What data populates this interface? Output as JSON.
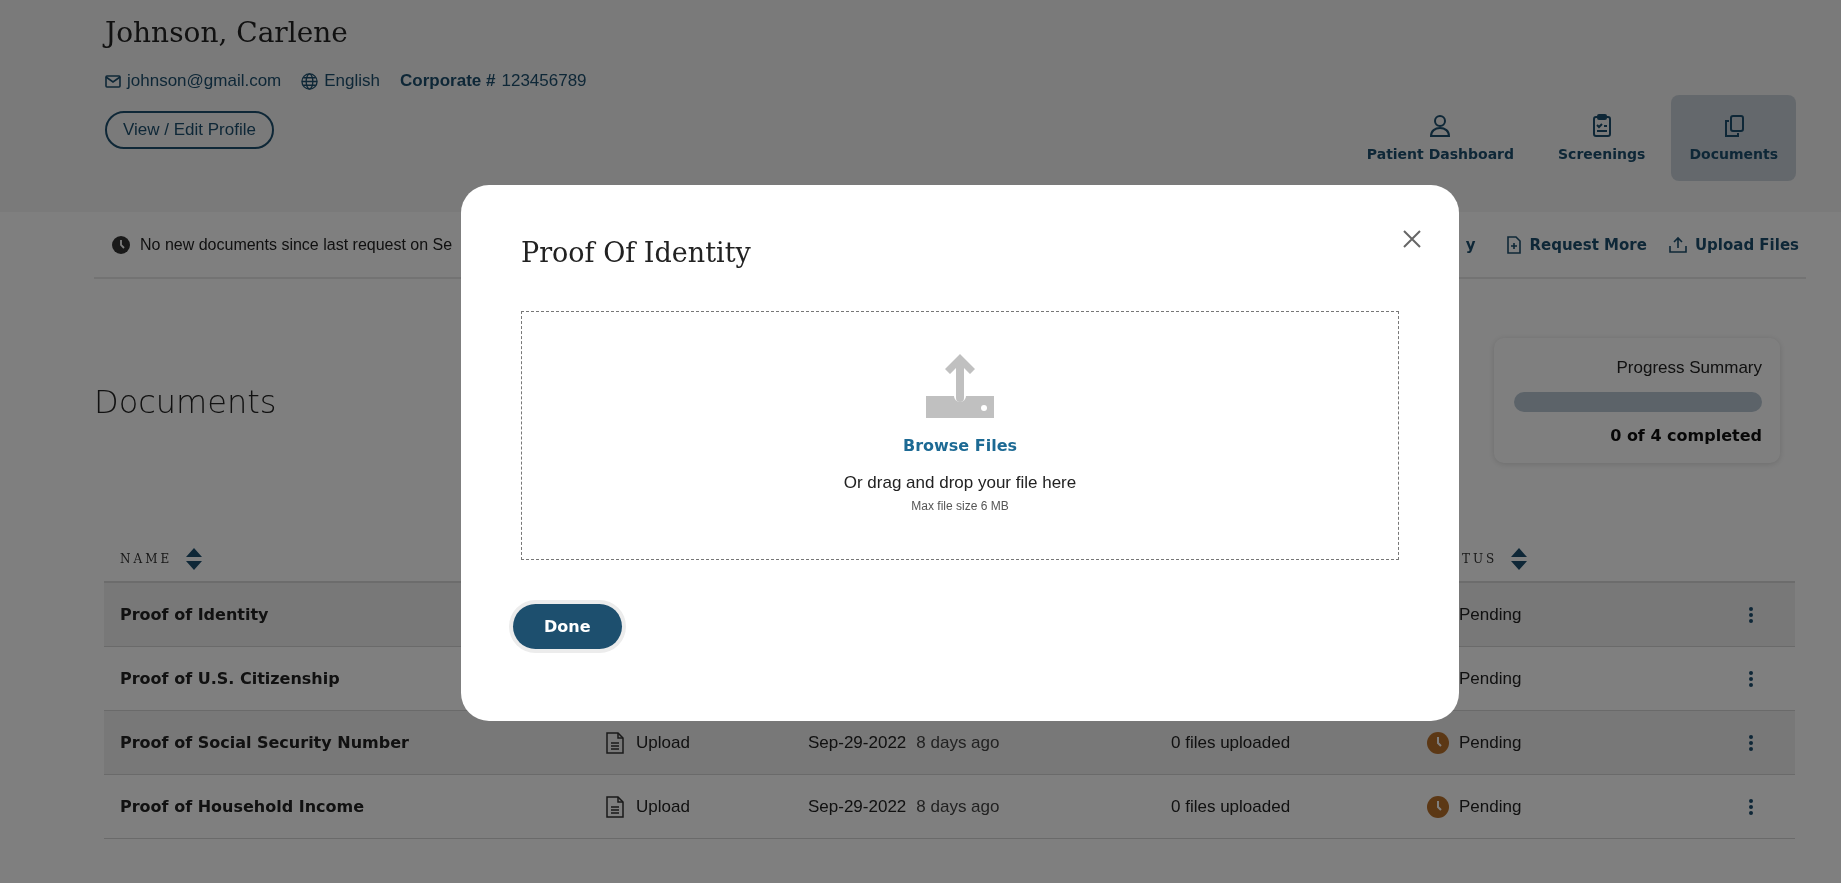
{
  "patient": {
    "name": "Johnson, Carlene",
    "email": "johnson@gmail.com",
    "language": "English",
    "corporate_label": "Corporate #",
    "corporate_number": "123456789",
    "profile_button": "View / Edit Profile"
  },
  "nav_tabs": [
    {
      "label": "Patient Dashboard",
      "kind": "person",
      "selected": false
    },
    {
      "label": "Screenings",
      "kind": "clipboard",
      "selected": false
    },
    {
      "label": "Documents",
      "kind": "copies",
      "selected": true
    }
  ],
  "notice": "No new documents since last request on Se",
  "toolbar_actions": [
    {
      "label": "y",
      "kind": "partial"
    },
    {
      "label": "Request More",
      "kind": "request"
    },
    {
      "label": "Upload Files",
      "kind": "upload"
    }
  ],
  "page_title": "Documents",
  "progress": {
    "title": "Progress Summary",
    "level": 0,
    "summary": "0 of 4 completed"
  },
  "table": {
    "columns": [
      {
        "label": "NAME"
      },
      {
        "label": "TUS"
      }
    ],
    "rows": [
      {
        "kind": "covered",
        "name": "Proof of Identity",
        "status": "Pending"
      },
      {
        "kind": "covered",
        "name": "Proof of U.S. Citizenship",
        "status": "Pending"
      },
      {
        "kind": "full",
        "name": "Proof of Social Security Number",
        "action": "Upload",
        "date": "Sep-29-2022",
        "ago": "8 days ago",
        "files": "0 files uploaded",
        "status": "Pending"
      },
      {
        "kind": "full",
        "name": "Proof of Household Income",
        "action": "Upload",
        "date": "Sep-29-2022",
        "ago": "8 days ago",
        "files": "0 files uploaded",
        "status": "Pending"
      }
    ]
  },
  "modal": {
    "title": "Proof Of Identity",
    "browse": "Browse Files",
    "drag_text": "Or drag and drop your file here",
    "max_size": "Max file size 6 MB",
    "done": "Done"
  }
}
